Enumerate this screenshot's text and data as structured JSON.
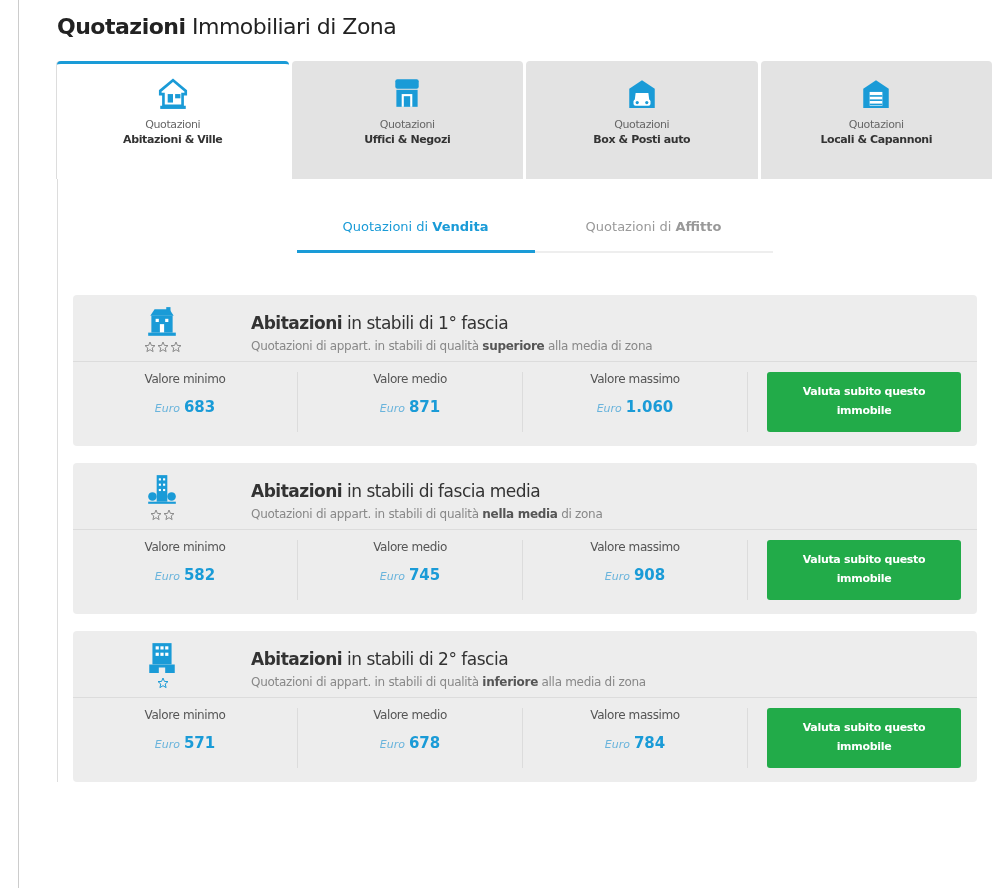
{
  "title": "**Quotazioni** Immobiliari di Zona",
  "tabs": [
    {
      "kind": "house",
      "line1": "Quotazioni",
      "line2": "Abitazioni & Ville",
      "selected": true
    },
    {
      "kind": "shop",
      "line1": "Quotazioni",
      "line2": "Uffici & Negozi",
      "selected": false
    },
    {
      "kind": "parking",
      "line1": "Quotazioni",
      "line2": "Box & Posti auto",
      "selected": false
    },
    {
      "kind": "warehouse",
      "line1": "Quotazioni",
      "line2": "Locali & Capannoni",
      "selected": false
    }
  ],
  "subtabs": [
    {
      "label": "Quotazioni di **Vendita**",
      "selected": true
    },
    {
      "label": "Quotazioni di **Affitto**",
      "selected": false
    }
  ],
  "cards": [
    {
      "kind": "premium",
      "title": "**Abitazioni** in stabili di 1° fascia",
      "subtitle": "Quotazioni di appart. in stabili di qualità **superiore** alla media di zona",
      "values": [
        {
          "label": "Valore minimo",
          "currency": "Euro",
          "amount": "683"
        },
        {
          "label": "Valore medio",
          "currency": "Euro",
          "amount": "871"
        },
        {
          "label": "Valore massimo",
          "currency": "Euro",
          "amount": "1.060"
        }
      ],
      "button": "Valuta subito questo immobile"
    },
    {
      "kind": "average",
      "title": "**Abitazioni** in stabili di fascia media",
      "subtitle": "Quotazioni di appart. in stabili di qualità **nella media** di zona",
      "values": [
        {
          "label": "Valore minimo",
          "currency": "Euro",
          "amount": "582"
        },
        {
          "label": "Valore medio",
          "currency": "Euro",
          "amount": "745"
        },
        {
          "label": "Valore massimo",
          "currency": "Euro",
          "amount": "908"
        }
      ],
      "button": "Valuta subito questo immobile"
    },
    {
      "kind": "basic",
      "title": "**Abitazioni** in stabili di 2° fascia",
      "subtitle": "Quotazioni di appart. in stabili di qualità **inferiore** alla media di zona",
      "values": [
        {
          "label": "Valore minimo",
          "currency": "Euro",
          "amount": "571"
        },
        {
          "label": "Valore medio",
          "currency": "Euro",
          "amount": "678"
        },
        {
          "label": "Valore massimo",
          "currency": "Euro",
          "amount": "784"
        }
      ],
      "button": "Valuta subito questo immobile"
    }
  ]
}
